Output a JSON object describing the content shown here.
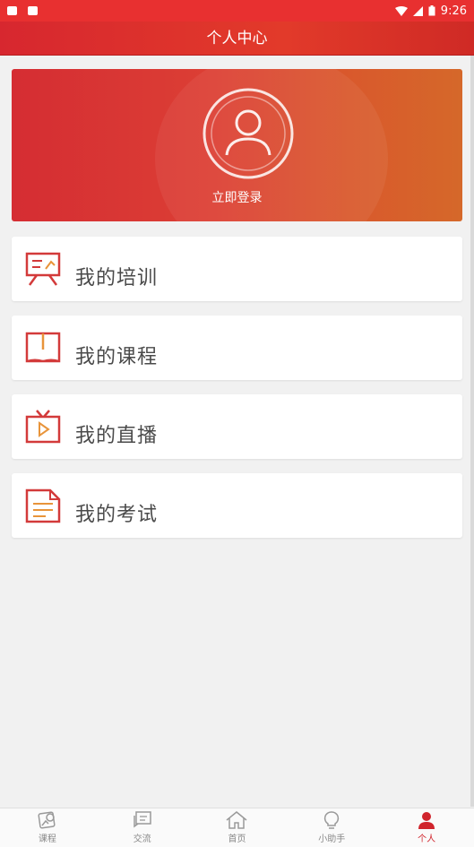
{
  "status_bar": {
    "time": "9:26"
  },
  "header": {
    "title": "个人中心"
  },
  "banner": {
    "login_label": "立即登录"
  },
  "menu": [
    {
      "label": "我的培训",
      "icon": "training-board-icon"
    },
    {
      "label": "我的课程",
      "icon": "book-icon"
    },
    {
      "label": "我的直播",
      "icon": "tv-live-icon"
    },
    {
      "label": "我的考试",
      "icon": "exam-document-icon"
    }
  ],
  "tabs": [
    {
      "label": "课程",
      "icon": "course-icon",
      "active": false
    },
    {
      "label": "交流",
      "icon": "chat-icon",
      "active": false
    },
    {
      "label": "首页",
      "icon": "home-icon",
      "active": false
    },
    {
      "label": "小助手",
      "icon": "lightbulb-icon",
      "active": false
    },
    {
      "label": "个人",
      "icon": "person-icon",
      "active": true
    }
  ],
  "colors": {
    "brand": "#d0242c",
    "icon_red": "#d33a3a",
    "text": "#4a4a4a"
  }
}
